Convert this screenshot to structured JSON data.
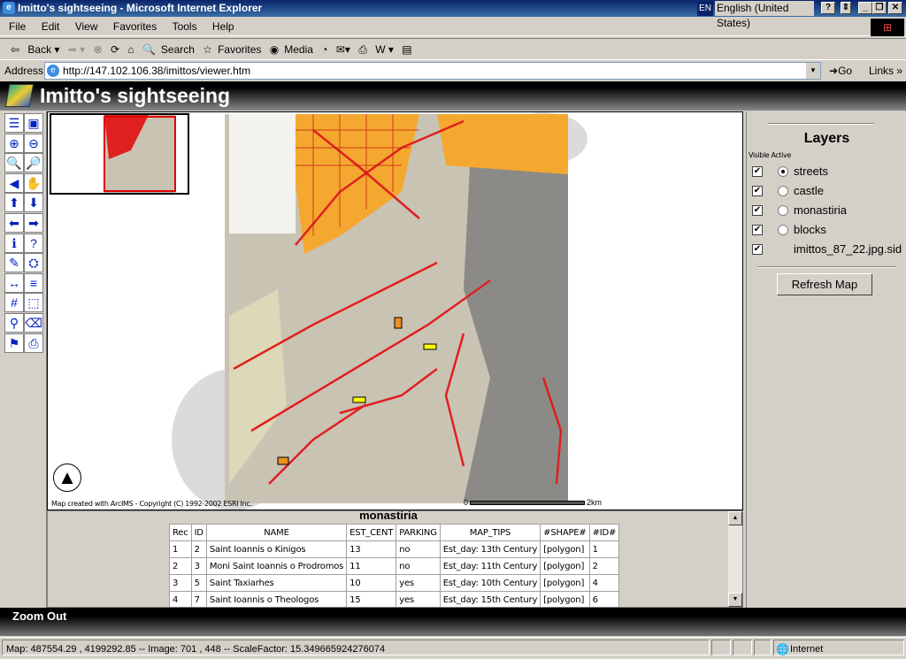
{
  "window": {
    "title": "Imitto's sightseeing - Microsoft Internet Explorer",
    "language": "English (United States)",
    "lang_code": "EN"
  },
  "menu": [
    "File",
    "Edit",
    "View",
    "Favorites",
    "Tools",
    "Help"
  ],
  "toolbar": {
    "back": "Back",
    "search": "Search",
    "favorites": "Favorites",
    "media": "Media"
  },
  "address": {
    "label": "Address",
    "url": "http://147.102.106.38/imittos/viewer.htm",
    "go": "Go",
    "links": "Links"
  },
  "banner": {
    "title": "Imitto's sightseeing"
  },
  "tools": [
    {
      "name": "legend-toggle",
      "glyph": "☰"
    },
    {
      "name": "overview-toggle",
      "glyph": "▣"
    },
    {
      "name": "zoom-in",
      "glyph": "⊕"
    },
    {
      "name": "zoom-out",
      "glyph": "⊖"
    },
    {
      "name": "zoom-full",
      "glyph": "🔍"
    },
    {
      "name": "zoom-active",
      "glyph": "🔎"
    },
    {
      "name": "zoom-previous",
      "glyph": "◀"
    },
    {
      "name": "pan",
      "glyph": "✋"
    },
    {
      "name": "pan-north",
      "glyph": "⬆"
    },
    {
      "name": "pan-south",
      "glyph": "⬇"
    },
    {
      "name": "pan-west",
      "glyph": "⬅"
    },
    {
      "name": "pan-east",
      "glyph": "➡"
    },
    {
      "name": "identify",
      "glyph": "ℹ"
    },
    {
      "name": "query",
      "glyph": "?"
    },
    {
      "name": "select-by-line",
      "glyph": "✎"
    },
    {
      "name": "find",
      "glyph": "⛭"
    },
    {
      "name": "measure",
      "glyph": "↔"
    },
    {
      "name": "set-units",
      "glyph": "≡"
    },
    {
      "name": "buffer",
      "glyph": "#"
    },
    {
      "name": "select-rectangle",
      "glyph": "⬚"
    },
    {
      "name": "select-by-shape",
      "glyph": "⚲"
    },
    {
      "name": "clear-selection",
      "glyph": "⌫"
    },
    {
      "name": "hyperlink",
      "glyph": "⚑"
    },
    {
      "name": "print",
      "glyph": "⎙"
    }
  ],
  "map": {
    "credit": "Map created with ArcIMS - Copyright (C) 1992-2002 ESRI Inc.",
    "scale_start": "0",
    "scale_end": "2km"
  },
  "table": {
    "title": "monastiria",
    "columns": [
      "Rec",
      "ID",
      "NAME",
      "EST_CENT",
      "PARKING",
      "MAP_TIPS",
      "#SHAPE#",
      "#ID#"
    ],
    "rows": [
      [
        "1",
        "2",
        "Saint Ioannis o Kinigos",
        "13",
        "no",
        "Est_day: 13th Century",
        "[polygon]",
        "1"
      ],
      [
        "2",
        "3",
        "Moni Saint Ioannis o Prodromos",
        "11",
        "no",
        "Est_day: 11th Century",
        "[polygon]",
        "2"
      ],
      [
        "3",
        "5",
        "Saint Taxiarhes",
        "10",
        "yes",
        "Est_day: 10th Century",
        "[polygon]",
        "4"
      ],
      [
        "4",
        "7",
        "Saint Ioannis o Theologos",
        "15",
        "yes",
        "Est_day: 15th Century",
        "[polygon]",
        "6"
      ]
    ]
  },
  "layers": {
    "title": "Layers",
    "visible_label": "Visible",
    "active_label": "Active",
    "items": [
      {
        "name": "streets",
        "visible": true,
        "active": true,
        "has_radio": true
      },
      {
        "name": "castle",
        "visible": true,
        "active": false,
        "has_radio": true
      },
      {
        "name": "monastiria",
        "visible": true,
        "active": false,
        "has_radio": true
      },
      {
        "name": "blocks",
        "visible": true,
        "active": false,
        "has_radio": true
      },
      {
        "name": "imittos_87_22.jpg.sid",
        "visible": true,
        "active": false,
        "has_radio": false
      }
    ],
    "refresh": "Refresh Map"
  },
  "mode": {
    "label": "Zoom Out"
  },
  "status": {
    "text": "Map: 487554.29 , 4199292.85 -- Image: 701 , 448 -- ScaleFactor: 15.349665924276074",
    "zone": "Internet"
  }
}
